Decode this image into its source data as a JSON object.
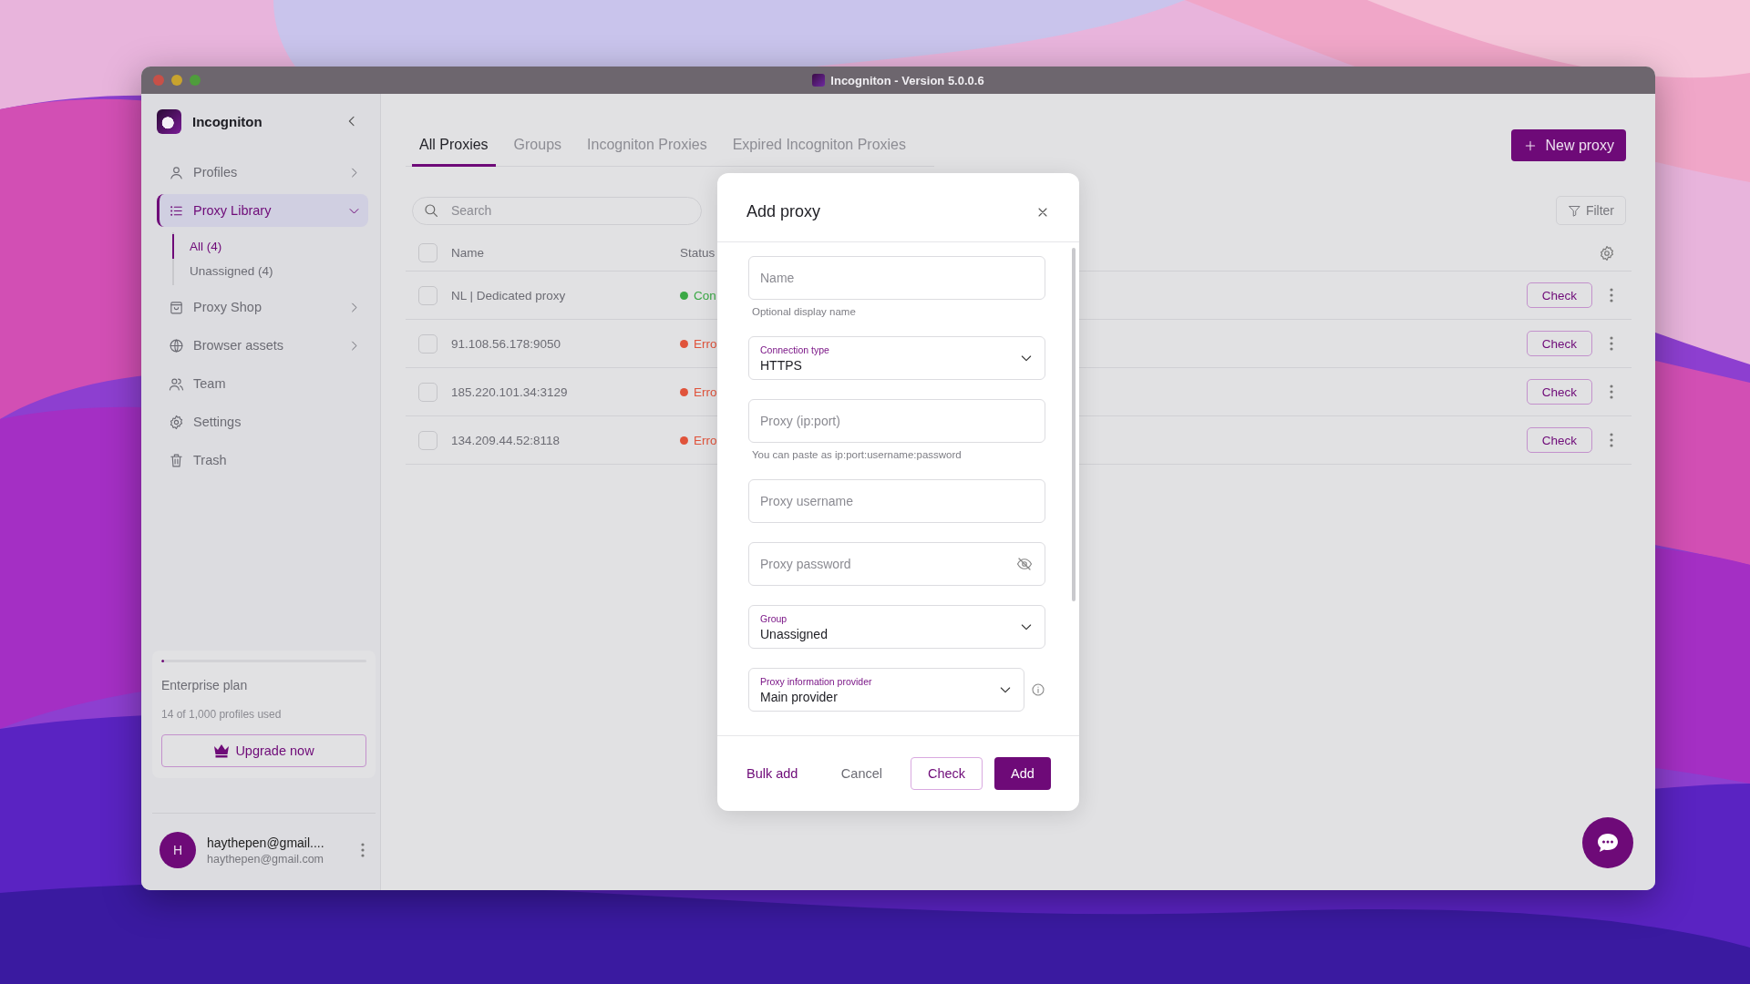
{
  "window": {
    "title": "Incogniton - Version 5.0.0.6"
  },
  "sidebar": {
    "app_name": "Incogniton",
    "items": [
      {
        "label": "Profiles",
        "expanded": false,
        "selected": false
      },
      {
        "label": "Proxy Library",
        "expanded": true,
        "selected": true,
        "children": [
          {
            "label": "All (4)",
            "selected": true
          },
          {
            "label": "Unassigned (4)",
            "selected": false
          }
        ]
      },
      {
        "label": "Proxy Shop",
        "expanded": false,
        "selected": false
      },
      {
        "label": "Browser assets",
        "expanded": false,
        "selected": false
      },
      {
        "label": "Team",
        "selected": false
      },
      {
        "label": "Settings",
        "selected": false
      },
      {
        "label": "Trash",
        "selected": false
      }
    ],
    "plan": {
      "name": "Enterprise plan",
      "usage": "14 of 1,000 profiles used",
      "level": 0.014,
      "button": "Upgrade now"
    },
    "user": {
      "initial": "H",
      "name": "haythepen@gmail....",
      "email": "haythepen@gmail.com"
    }
  },
  "tabs": [
    {
      "label": "All Proxies",
      "selected": true
    },
    {
      "label": "Groups",
      "selected": false
    },
    {
      "label": "Incogniton Proxies",
      "selected": false
    },
    {
      "label": "Expired Incogniton Proxies",
      "selected": false
    }
  ],
  "new_button": "New proxy",
  "search": {
    "placeholder": "Search"
  },
  "filter_button": "Filter",
  "table": {
    "header_checked": false,
    "columns": [
      "Name",
      "Status"
    ],
    "rows": [
      {
        "checked": false,
        "name": "NL | Dedicated proxy",
        "status": "Con",
        "color": "#3aa845",
        "action": "Check"
      },
      {
        "checked": false,
        "name": "91.108.56.178:9050",
        "status": "Erro",
        "color": "#e0533b",
        "action": "Check"
      },
      {
        "checked": false,
        "name": "185.220.101.34:3129",
        "status": "Erro",
        "color": "#e0533b",
        "action": "Check"
      },
      {
        "checked": false,
        "name": "134.209.44.52:8118",
        "status": "Erro",
        "color": "#e0533b",
        "action": "Check"
      }
    ]
  },
  "modal": {
    "title": "Add proxy",
    "fields": [
      {
        "kind": "text",
        "placeholder": "Name",
        "helper": "Optional display name"
      },
      {
        "kind": "select",
        "label": "Connection type",
        "value": "HTTPS"
      },
      {
        "kind": "text",
        "placeholder": "Proxy (ip:port)",
        "helper": "You can paste as ip:port:username:password"
      },
      {
        "kind": "text",
        "placeholder": "Proxy username"
      },
      {
        "kind": "password",
        "placeholder": "Proxy password"
      },
      {
        "kind": "select",
        "label": "Group",
        "value": "Unassigned"
      },
      {
        "kind": "select",
        "label": "Proxy information provider",
        "value": "Main provider",
        "info": true
      }
    ],
    "buttons": [
      {
        "kind": "link",
        "label": "Bulk add"
      },
      {
        "kind": "plain",
        "label": "Cancel"
      },
      {
        "kind": "outline",
        "label": "Check"
      },
      {
        "kind": "primary",
        "label": "Add"
      }
    ]
  }
}
